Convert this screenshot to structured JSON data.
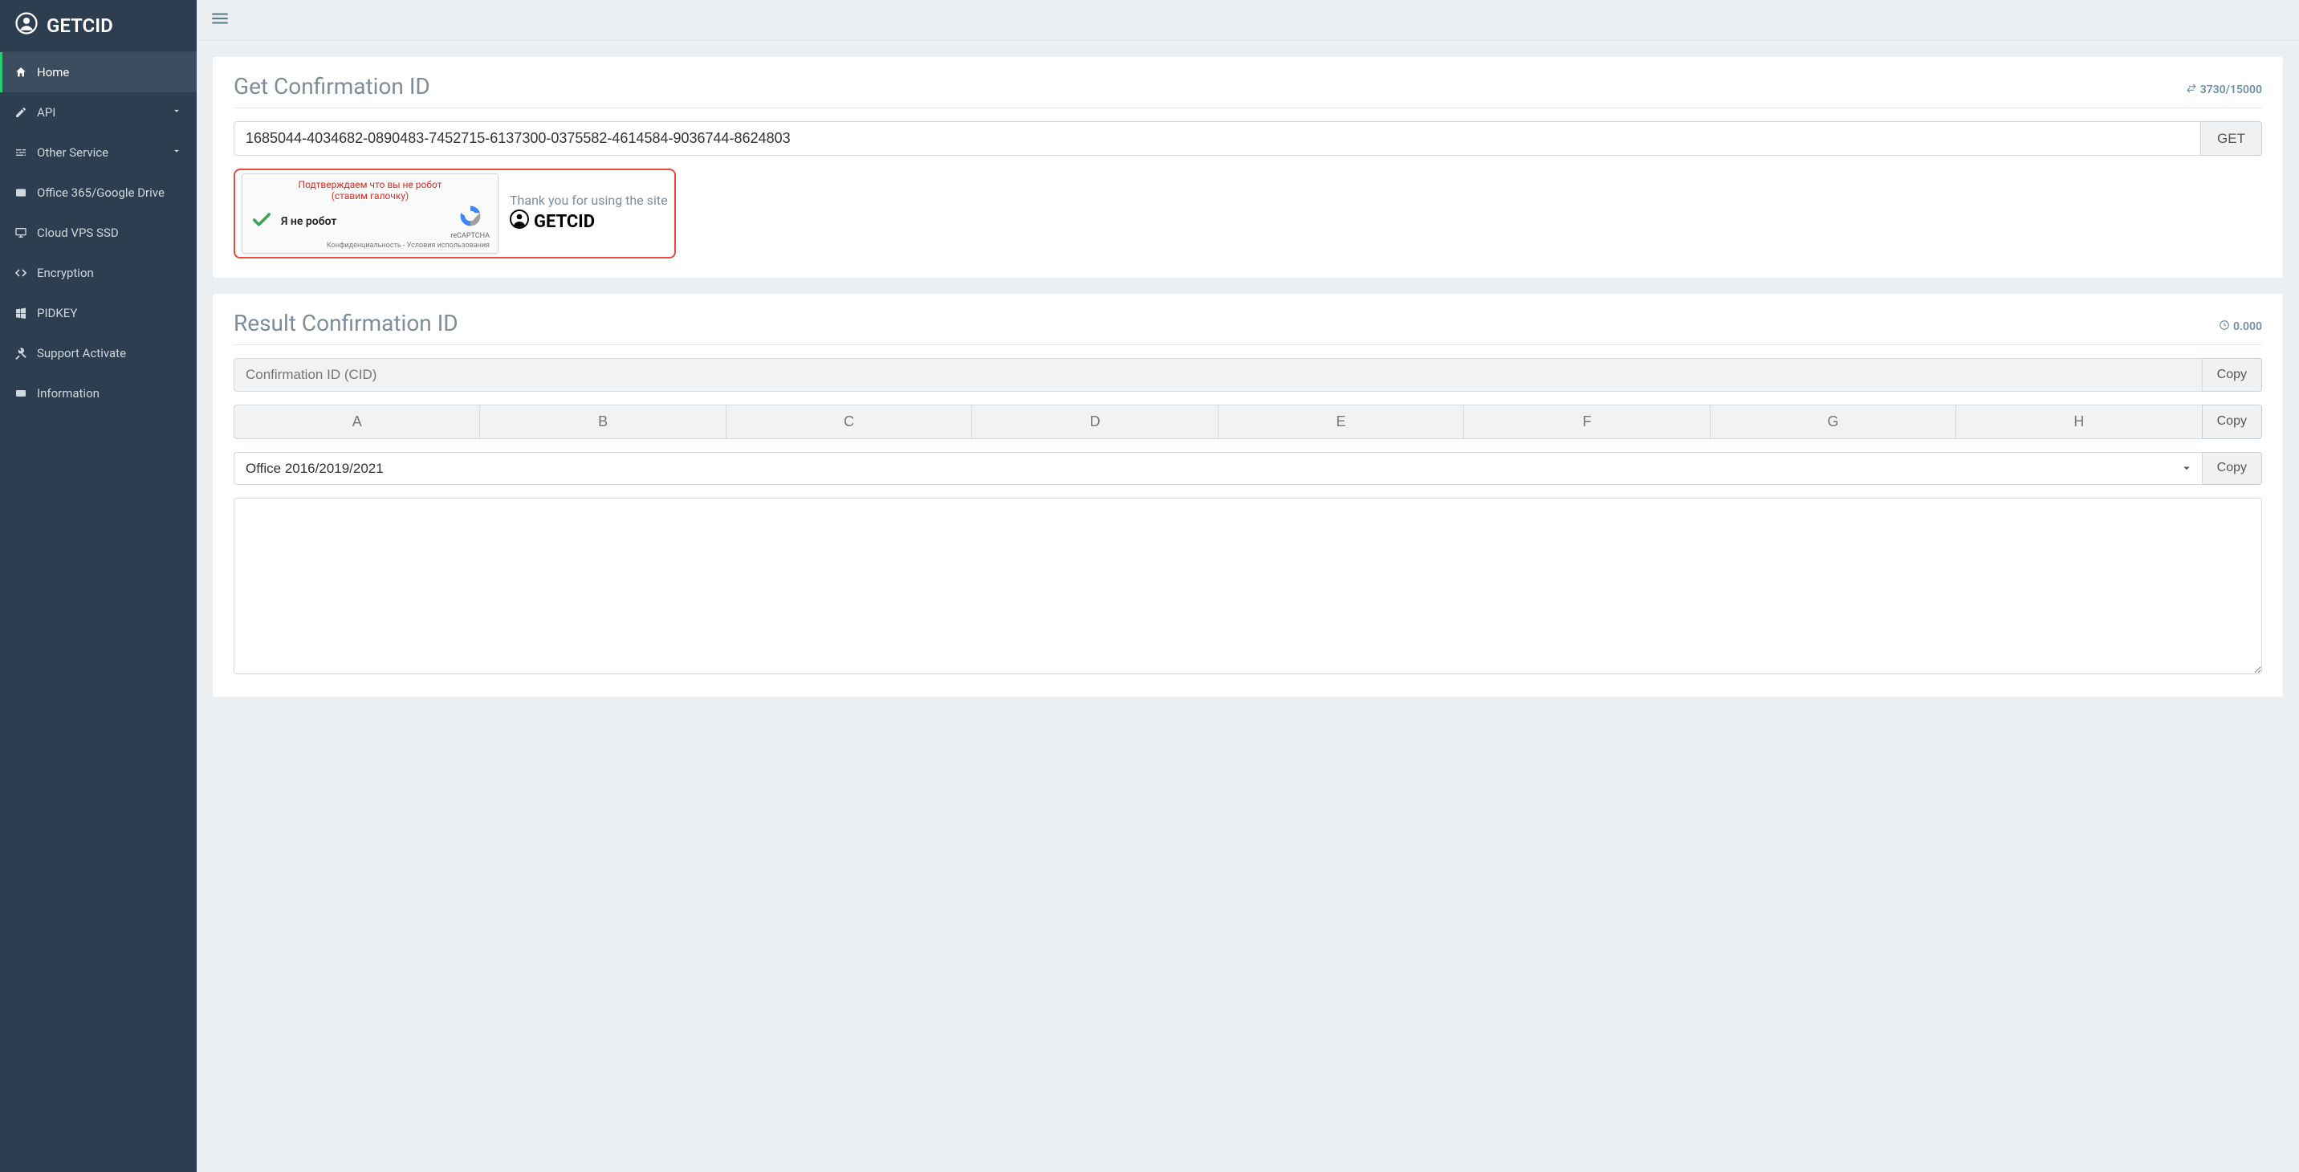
{
  "brand": "GETCID",
  "sidebar": {
    "items": [
      {
        "label": "Home",
        "icon": "home-icon",
        "active": true,
        "chevron": false
      },
      {
        "label": "API",
        "icon": "edit-icon",
        "active": false,
        "chevron": true
      },
      {
        "label": "Other Service",
        "icon": "sliders-icon",
        "active": false,
        "chevron": true
      },
      {
        "label": "Office 365/Google Drive",
        "icon": "card-icon",
        "active": false,
        "chevron": false
      },
      {
        "label": "Cloud VPS SSD",
        "icon": "monitor-icon",
        "active": false,
        "chevron": false
      },
      {
        "label": "Encryption",
        "icon": "code-icon",
        "active": false,
        "chevron": false
      },
      {
        "label": "PIDKEY",
        "icon": "windows-icon",
        "active": false,
        "chevron": false
      },
      {
        "label": "Support Activate",
        "icon": "tools-icon",
        "active": false,
        "chevron": false
      },
      {
        "label": "Information",
        "icon": "id-icon",
        "active": false,
        "chevron": false
      }
    ]
  },
  "get_panel": {
    "title": "Get Confirmation ID",
    "counter": "3730/15000",
    "input_value": "1685044-4034682-0890483-7452715-6137300-0375582-4614584-9036744-8624803",
    "get_btn": "GET"
  },
  "captcha": {
    "warn_line1": "Подтверждаем что вы не робот",
    "warn_line2": "(ставим галочку)",
    "not_robot": "Я не робот",
    "rc_label": "reCAPTCHA",
    "privacy": "Конфиденциальность",
    "terms_sep": " - ",
    "terms": "Условия использования"
  },
  "thanks": {
    "text": "Thank you for using the site",
    "logo_text": "GETCID"
  },
  "result_panel": {
    "title": "Result Confirmation ID",
    "timing": "0.000",
    "cid_placeholder": "Confirmation ID (CID)",
    "copy": "Copy",
    "segments": [
      "A",
      "B",
      "C",
      "D",
      "E",
      "F",
      "G",
      "H"
    ],
    "select_value": "Office 2016/2019/2021"
  }
}
